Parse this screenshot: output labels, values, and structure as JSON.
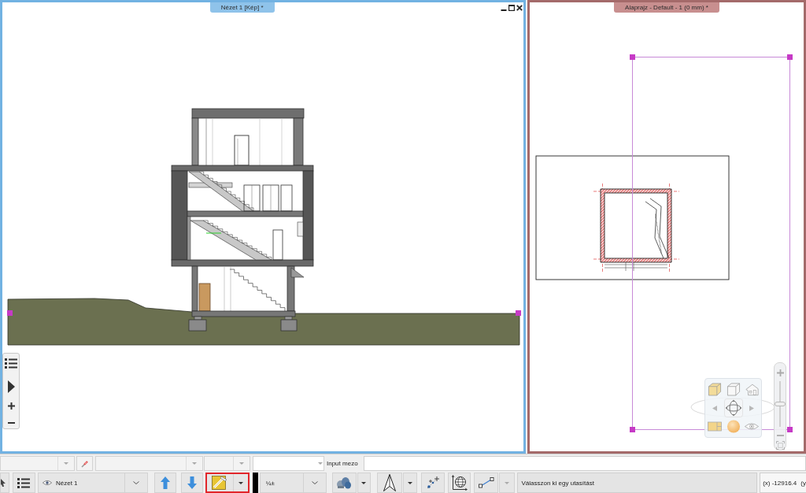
{
  "viewports": [
    {
      "title": "Nézet 1 [Kép] *",
      "kind": "section",
      "active": true
    },
    {
      "title": "Alaprajz - Default - 1 (0 mm) *",
      "kind": "plan",
      "active": false
    }
  ],
  "nav_widget": {
    "zoom_slider": {
      "level": 0.5
    }
  },
  "input_bar": {
    "label": "Input mezo"
  },
  "toolbar": {
    "view_dropdown": {
      "value": "Nézet 1"
    },
    "tool_button": {
      "selected": true
    },
    "pen_dropdown": {
      "value": "¼±"
    }
  },
  "status_bar": {
    "message": "Válasszon ki egy utasítást",
    "coordinates": [
      "(x) -12916.4",
      "(y"
    ]
  }
}
